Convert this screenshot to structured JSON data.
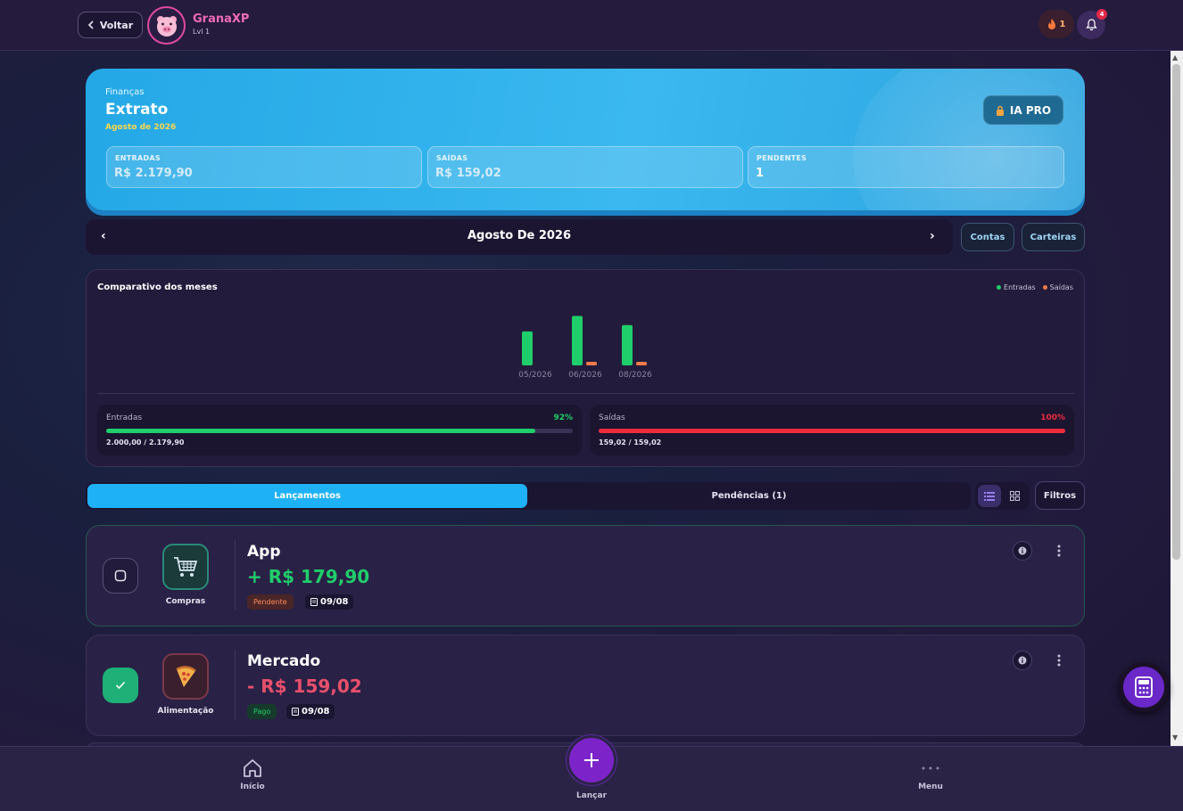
{
  "header": {
    "back_label": "Voltar",
    "app_name": "GranaXP",
    "level": "Lvl 1",
    "streak_count": "1",
    "notification_count": "4"
  },
  "hero": {
    "eyebrow": "Finanças",
    "title": "Extrato",
    "subtitle": "Agosto de 2026",
    "ia_button": "IA PRO",
    "stats": [
      {
        "label": "ENTRADAS",
        "value": "R$ 2.179,90"
      },
      {
        "label": "SAÍDAS",
        "value": "R$ 159,02"
      },
      {
        "label": "PENDENTES",
        "value": "1"
      }
    ]
  },
  "month_nav": {
    "prev": "‹",
    "label": "Agosto De 2026",
    "next": "›",
    "accounts_button": "Contas",
    "wallets_button": "Carteiras"
  },
  "chart_data": {
    "type": "bar",
    "title": "Comparativo dos meses",
    "categories": [
      "05/2026",
      "06/2026",
      "08/2026"
    ],
    "series": [
      {
        "name": "Entradas",
        "color": "#1fce6a",
        "values": [
          1500,
          2180,
          1780
        ]
      },
      {
        "name": "Saídas",
        "color": "#f07a4a",
        "values": [
          0,
          159,
          159
        ]
      }
    ],
    "ylim": [
      0,
      2200
    ],
    "legend_position": "top-right",
    "grid": false
  },
  "progress": {
    "income": {
      "label": "Entradas",
      "percent_text": "92%",
      "fraction": 0.92,
      "amounts": "2.000,00 / 2.179,90",
      "color": "#1fce6a"
    },
    "expense": {
      "label": "Saídas",
      "percent_text": "100%",
      "fraction": 1.0,
      "amounts": "159,02 / 159,02",
      "color": "#ef2b3c"
    }
  },
  "tabs": {
    "entries": "Lançamentos",
    "pending": "Pendências (1)",
    "filters": "Filtros"
  },
  "transactions": [
    {
      "name": "App",
      "amount": "+ R$ 179,90",
      "category": "Compras",
      "status": "Pendente",
      "date": "09/08",
      "checked": false,
      "category_icon": "shopping-cart-icon"
    },
    {
      "name": "Mercado",
      "amount": "- R$ 159,02",
      "category": "Alimentação",
      "status": "Pago",
      "date": "09/08",
      "checked": true,
      "category_icon": "pizza-icon"
    }
  ],
  "bottom_nav": {
    "home": "Início",
    "launch": "Lançar",
    "menu": "Menu"
  },
  "colors": {
    "income": "#1fce6a",
    "expense": "#e8506b",
    "accent": "#1fb1f5",
    "fab": "#7c24c9"
  }
}
